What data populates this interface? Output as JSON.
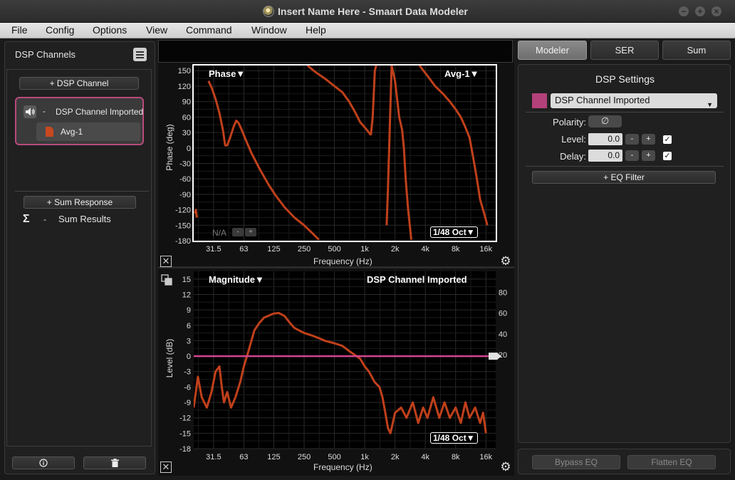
{
  "window": {
    "title": "Insert Name Here - Smaart Data Modeler",
    "controls": [
      "−",
      "+",
      "×"
    ]
  },
  "menu": [
    "File",
    "Config",
    "Options",
    "View",
    "Command",
    "Window",
    "Help"
  ],
  "left_panel": {
    "title": "DSP Channels",
    "add_channel_label": "+ DSP Channel",
    "channel": {
      "dash": "-",
      "name": "DSP Channel Imported",
      "measurement": "Avg-1"
    },
    "add_sum_label": "+ Sum Response",
    "sum": {
      "dash": "-",
      "name": "Sum Results"
    },
    "info_icon": "info-icon",
    "delete_icon": "trash-icon"
  },
  "phase_plot": {
    "title": "Phase▼",
    "source": "Avg-1▼",
    "resolution": "1/48 Oct▼",
    "na_label": "N/A",
    "minus_label": "-",
    "plus_label": "+",
    "ylabel": "Phase (deg)",
    "xlabel": "Frequency (Hz)",
    "y_ticks": [
      "150",
      "120",
      "90",
      "60",
      "30",
      "0",
      "-30",
      "-60",
      "-90",
      "-120",
      "-150",
      "-180"
    ],
    "x_ticks": [
      "31.5",
      "63",
      "125",
      "250",
      "500",
      "1k",
      "2k",
      "4k",
      "8k",
      "16k"
    ],
    "close_label": "✕",
    "gear_label": "⚙"
  },
  "magnitude_plot": {
    "title": "Magnitude▼",
    "source": "DSP Channel Imported",
    "resolution": "1/48 Oct▼",
    "ylabel": "Level (dB)",
    "xlabel": "Frequency (Hz)",
    "y_ticks": [
      "15",
      "12",
      "9",
      "6",
      "3",
      "0",
      "-3",
      "-6",
      "-9",
      "-12",
      "-15",
      "-18"
    ],
    "y2_ticks": [
      "80",
      "60",
      "40",
      "20"
    ],
    "x_ticks": [
      "31.5",
      "63",
      "125",
      "250",
      "500",
      "1k",
      "2k",
      "4k",
      "8k",
      "16k"
    ],
    "close_label": "✕",
    "gear_label": "⚙"
  },
  "right_panel": {
    "tabs": [
      "Modeler",
      "SER",
      "Sum"
    ],
    "active_tab": "Modeler",
    "title": "DSP Settings",
    "selected_channel": "DSP Channel Imported",
    "channel_color": "#b4417a",
    "polarity_label": "Polarity:",
    "polarity_symbol": "∅",
    "level_label": "Level:",
    "level_value": "0.0",
    "level_enabled": true,
    "delay_label": "Delay:",
    "delay_value": "0.0",
    "delay_enabled": true,
    "minus": "-",
    "plus": "+",
    "check": "✓",
    "add_eq_label": "+ EQ Filter",
    "bypass_eq_label": "Bypass EQ",
    "flatten_eq_label": "Flatten EQ"
  },
  "chart_data": [
    {
      "type": "line",
      "title": "Phase",
      "xlabel": "Frequency (Hz)",
      "ylabel": "Phase (deg)",
      "x_scale": "log",
      "xlim": [
        20,
        20000
      ],
      "ylim": [
        -180,
        160
      ],
      "grid": true,
      "series": [
        {
          "name": "Avg-1",
          "color": "#c0401b",
          "segments": [
            [
              [
                20.5,
                -127
              ],
              [
                21,
                -120
              ],
              [
                21.5,
                -135
              ]
            ],
            [
              [
                28,
                130
              ],
              [
                30,
                118
              ],
              [
                33,
                95
              ],
              [
                36,
                68
              ],
              [
                39,
                35
              ],
              [
                41,
                5
              ],
              [
                43,
                5
              ],
              [
                46,
                20
              ],
              [
                50,
                42
              ],
              [
                53,
                53
              ],
              [
                56,
                48
              ],
              [
                60,
                35
              ],
              [
                66,
                15
              ],
              [
                75,
                -10
              ],
              [
                90,
                -40
              ],
              [
                110,
                -70
              ],
              [
                130,
                -92
              ],
              [
                160,
                -115
              ],
              [
                200,
                -135
              ],
              [
                250,
                -150
              ],
              [
                300,
                -165
              ],
              [
                350,
                -178
              ]
            ],
            [
              [
                270,
                160
              ],
              [
                320,
                148
              ],
              [
                400,
                135
              ],
              [
                500,
                120
              ],
              [
                600,
                108
              ],
              [
                700,
                90
              ],
              [
                800,
                70
              ],
              [
                900,
                50
              ],
              [
                1000,
                40
              ],
              [
                1100,
                30
              ],
              [
                1150,
                25
              ]
            ],
            [
              [
                1150,
                25
              ],
              [
                1200,
                60
              ],
              [
                1260,
                150
              ],
              [
                1300,
                160
              ]
            ],
            [
              [
                1650,
                -150
              ],
              [
                1700,
                -80
              ],
              [
                1780,
                50
              ],
              [
                1850,
                160
              ]
            ],
            [
              [
                1850,
                160
              ],
              [
                2000,
                130
              ],
              [
                2200,
                60
              ],
              [
                2350,
                35
              ],
              [
                2450,
                0
              ],
              [
                2550,
                -60
              ],
              [
                2700,
                -120
              ],
              [
                2900,
                -178
              ]
            ],
            [
              [
                3500,
                160
              ],
              [
                4200,
                140
              ],
              [
                5000,
                120
              ],
              [
                6000,
                105
              ],
              [
                7000,
                90
              ],
              [
                8000,
                75
              ],
              [
                9000,
                60
              ],
              [
                10000,
                40
              ],
              [
                11000,
                20
              ],
              [
                12000,
                -20
              ],
              [
                13000,
                -60
              ],
              [
                14000,
                -100
              ],
              [
                15500,
                -130
              ],
              [
                16500,
                -150
              ]
            ]
          ]
        }
      ]
    },
    {
      "type": "line",
      "title": "Magnitude",
      "xlabel": "Frequency (Hz)",
      "ylabel": "Level (dB)",
      "x_scale": "log",
      "xlim": [
        20,
        20000
      ],
      "ylim": [
        -18,
        16.5
      ],
      "y2lim": [
        -70,
        100
      ],
      "grid": true,
      "series": [
        {
          "name": "Avg-1",
          "color": "#c0401b",
          "values": [
            [
              20,
              -10
            ],
            [
              22,
              -4
            ],
            [
              24,
              -8
            ],
            [
              27,
              -10
            ],
            [
              30,
              -7
            ],
            [
              33,
              -3
            ],
            [
              36,
              -2
            ],
            [
              38,
              -6
            ],
            [
              40,
              -9
            ],
            [
              43,
              -7
            ],
            [
              47,
              -10
            ],
            [
              52,
              -8
            ],
            [
              58,
              -5
            ],
            [
              63,
              -2
            ],
            [
              70,
              1
            ],
            [
              80,
              5
            ],
            [
              90,
              6.5
            ],
            [
              100,
              7.5
            ],
            [
              115,
              8
            ],
            [
              125,
              8.3
            ],
            [
              140,
              8.4
            ],
            [
              160,
              7.8
            ],
            [
              180,
              6.5
            ],
            [
              200,
              5.5
            ],
            [
              250,
              4.5
            ],
            [
              300,
              4
            ],
            [
              350,
              3.5
            ],
            [
              400,
              3
            ],
            [
              500,
              2.5
            ],
            [
              600,
              2
            ],
            [
              700,
              1
            ],
            [
              800,
              0.2
            ],
            [
              900,
              -0.5
            ],
            [
              1000,
              -2
            ],
            [
              1100,
              -3
            ],
            [
              1250,
              -5
            ],
            [
              1400,
              -6
            ],
            [
              1500,
              -8
            ],
            [
              1600,
              -11
            ],
            [
              1700,
              -14
            ],
            [
              1800,
              -15
            ],
            [
              1900,
              -13
            ],
            [
              2000,
              -11
            ],
            [
              2300,
              -10
            ],
            [
              2600,
              -12
            ],
            [
              3000,
              -9
            ],
            [
              3400,
              -13
            ],
            [
              3800,
              -10
            ],
            [
              4200,
              -12
            ],
            [
              4800,
              -8
            ],
            [
              5500,
              -12
            ],
            [
              6200,
              -9
            ],
            [
              7000,
              -12
            ],
            [
              8000,
              -10
            ],
            [
              9000,
              -13
            ],
            [
              10000,
              -9
            ],
            [
              11000,
              -12
            ],
            [
              12500,
              -10
            ],
            [
              14000,
              -13
            ],
            [
              15000,
              -11
            ],
            [
              16000,
              -15
            ]
          ]
        },
        {
          "name": "DSP Channel Imported",
          "color": "#d24590",
          "values": [
            [
              20,
              0
            ],
            [
              20000,
              0
            ]
          ]
        }
      ]
    }
  ]
}
